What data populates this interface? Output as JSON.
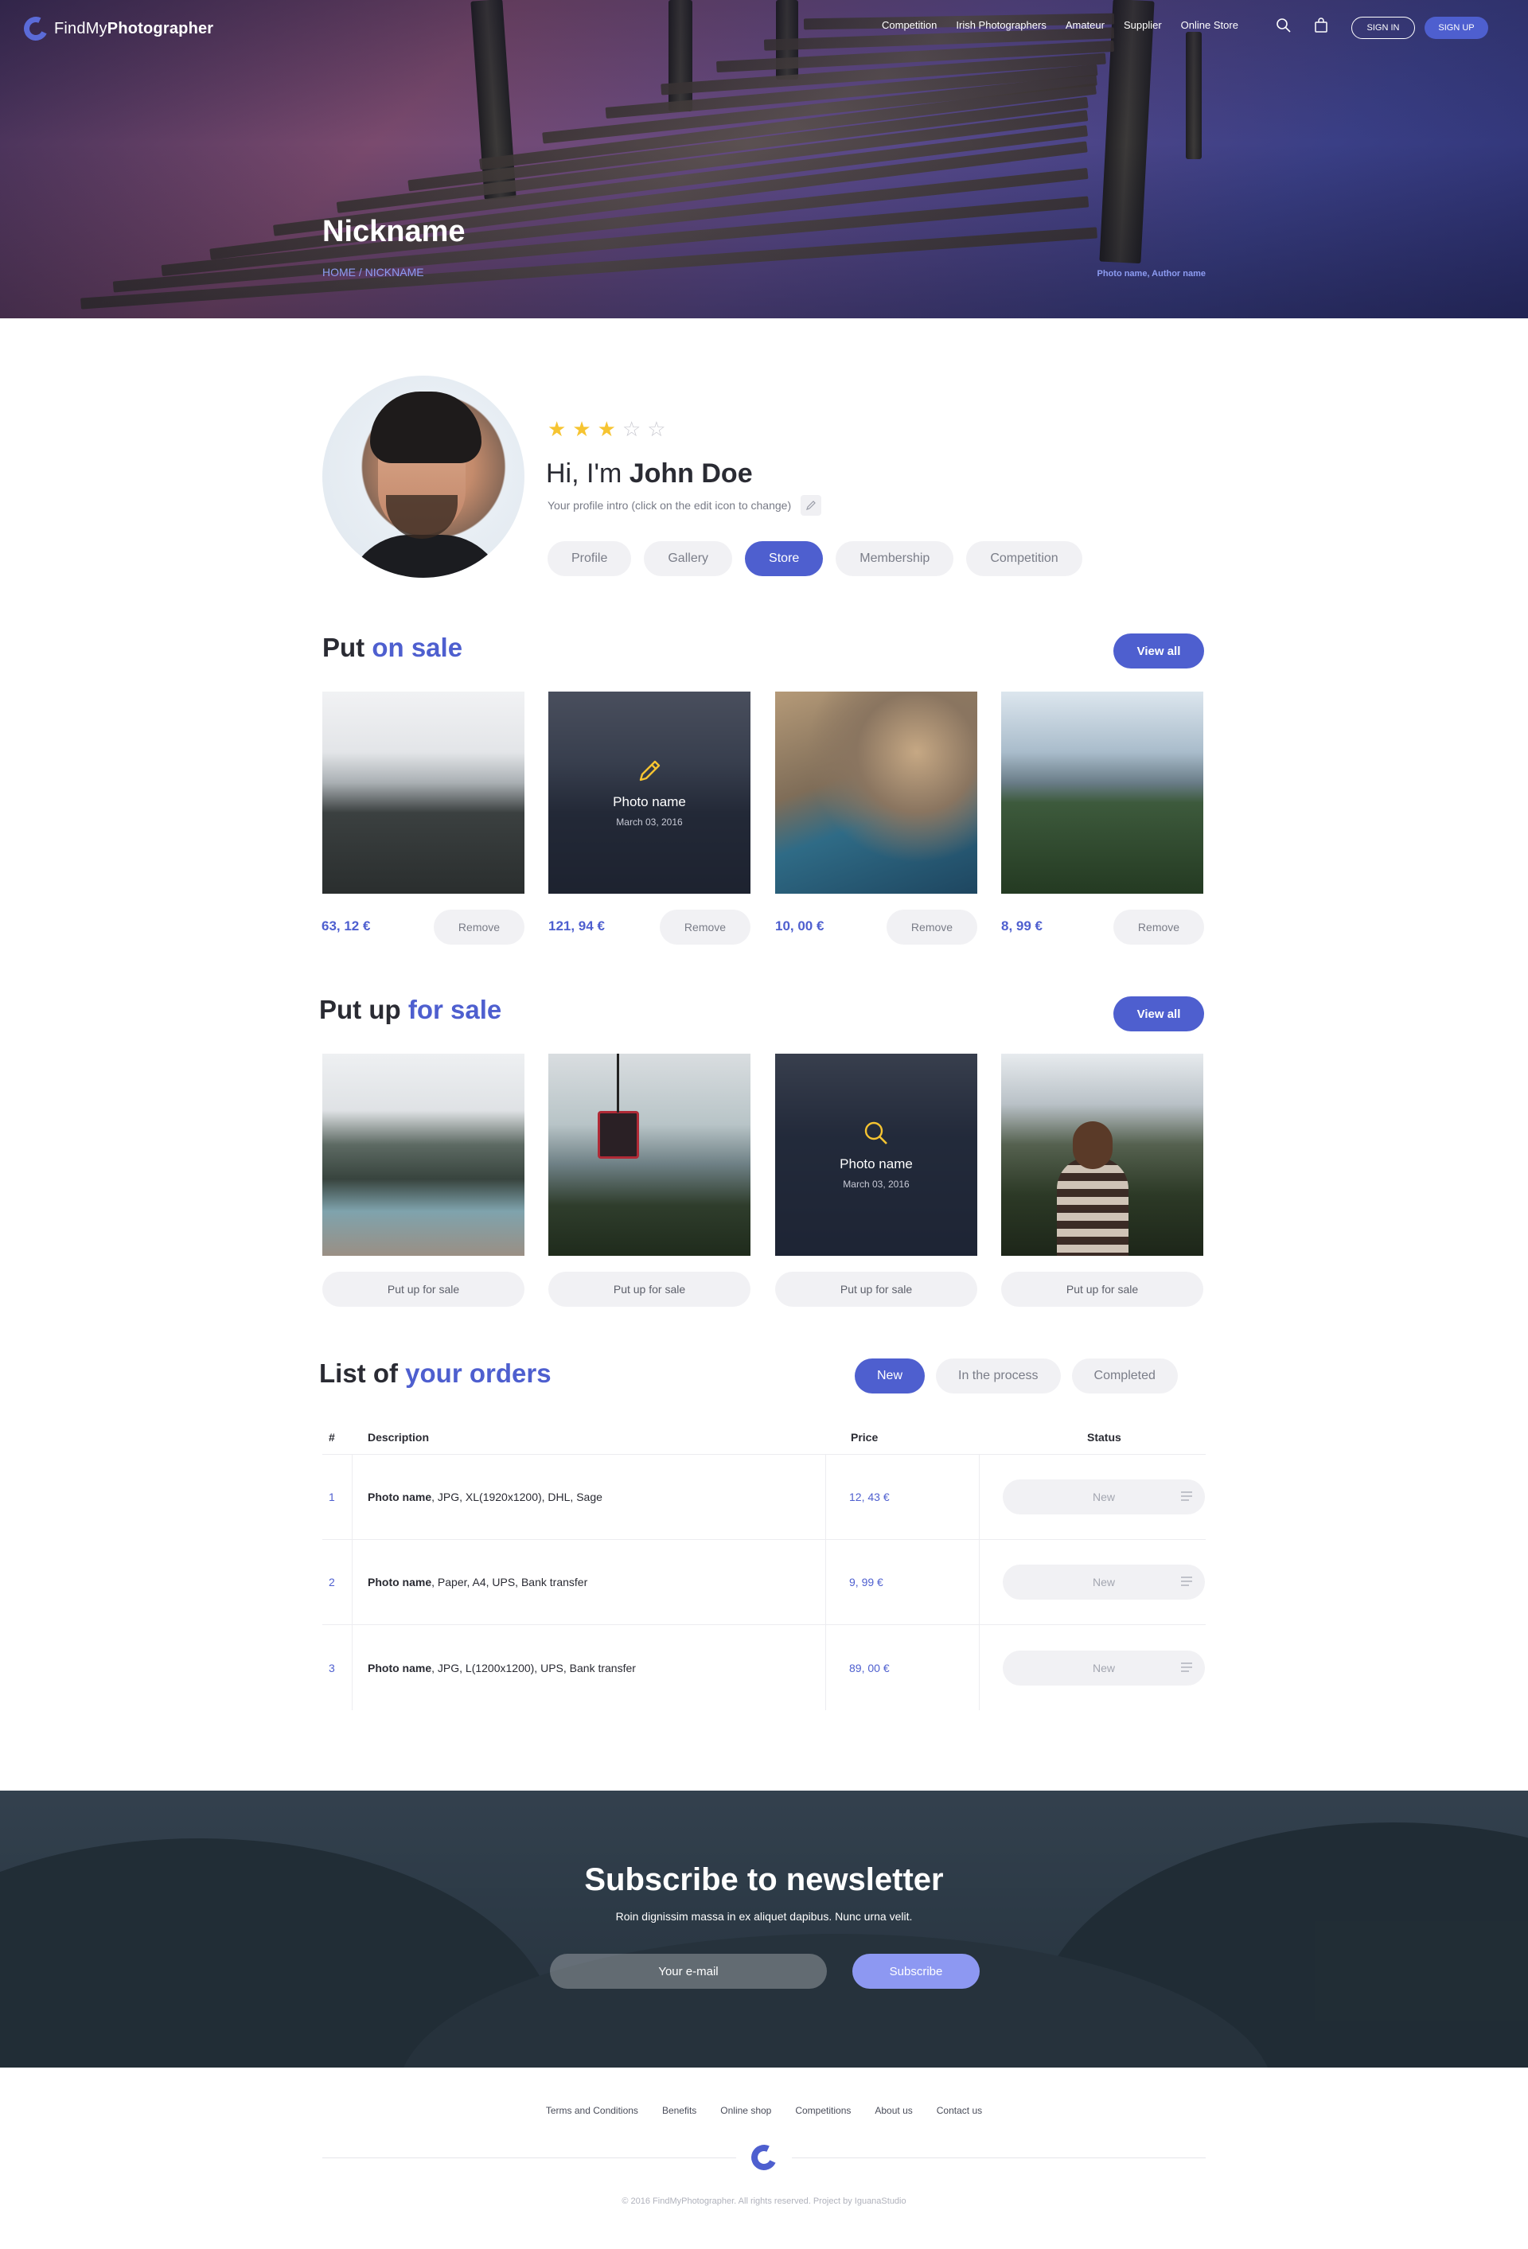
{
  "header": {
    "logo_light": "FindMy",
    "logo_bold": "Photographer",
    "nav": [
      "Competition",
      "Irish Photographers",
      "Amateur",
      "Supplier",
      "Online Store"
    ],
    "signin_label": "SIGN IN",
    "signup_label": "SIGN UP"
  },
  "hero": {
    "title": "Nickname",
    "breadcrumb": "HOME / NICKNAME",
    "credit": "Photo name, Author name"
  },
  "profile": {
    "rating": 3,
    "rating_max": 5,
    "greeting_prefix": "Hi, I'm",
    "name": "John Doe",
    "intro": "Your profile intro (click on the edit icon to change)",
    "tabs": [
      "Profile",
      "Gallery",
      "Store",
      "Membership",
      "Competition"
    ],
    "active_tab": "Store"
  },
  "on_sale": {
    "title_prefix": "Put",
    "title_accent": "on sale",
    "view_all": "View all",
    "overlay_icon": "pencil-icon",
    "items": [
      {
        "price": "63, 12 €",
        "remove": "Remove"
      },
      {
        "price": "121, 94 €",
        "remove": "Remove",
        "overlay_name": "Photo name",
        "overlay_date": "March 03, 2016"
      },
      {
        "price": "10, 00 €",
        "remove": "Remove"
      },
      {
        "price": "8, 99 €",
        "remove": "Remove"
      }
    ]
  },
  "for_sale": {
    "title_prefix": "Put up",
    "title_accent": "for sale",
    "view_all": "View all",
    "overlay_icon": "search-icon",
    "items": [
      {
        "action": "Put up for sale"
      },
      {
        "action": "Put up for sale"
      },
      {
        "action": "Put up for sale",
        "overlay_name": "Photo name",
        "overlay_date": "March 03, 2016"
      },
      {
        "action": "Put up for sale"
      }
    ]
  },
  "orders": {
    "title_prefix": "List of",
    "title_accent": "your orders",
    "filters": [
      "New",
      "In the process",
      "Completed"
    ],
    "active_filter": "New",
    "columns": [
      "#",
      "Description",
      "Price",
      "Status"
    ],
    "rows": [
      {
        "num": "1",
        "name": "Photo name",
        "details": ", JPG, XL(1920x1200), DHL, Sage",
        "price": "12, 43 €",
        "status": "New"
      },
      {
        "num": "2",
        "name": "Photo name",
        "details": ", Paper, A4, UPS, Bank transfer",
        "price": "9, 99 €",
        "status": "New"
      },
      {
        "num": "3",
        "name": "Photo name",
        "details": ", JPG, L(1200x1200), UPS, Bank transfer",
        "price": "89, 00 €",
        "status": "New"
      }
    ]
  },
  "newsletter": {
    "title_prefix": "Subscribe to",
    "title_accent": "newsletter",
    "subtitle": "Roin dignissim massa in ex aliquet dapibus. Nunc urna velit.",
    "email_placeholder": "Your e-mail",
    "button": "Subscribe"
  },
  "footer": {
    "links": [
      "Terms and Conditions",
      "Benefits",
      "Online shop",
      "Competitions",
      "About us",
      "Contact us"
    ],
    "copyright": "© 2016 FindMyPhotographer. All rights reserved. Project by IguanaStudio"
  },
  "colors": {
    "accent": "#4e5fcf",
    "star": "#f6c431",
    "pill_bg": "#f1f1f4"
  }
}
